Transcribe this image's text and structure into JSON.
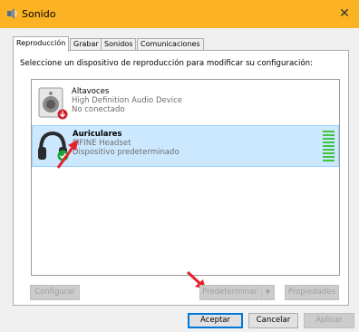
{
  "window": {
    "title": "Sonido",
    "close_glyph": "✕",
    "titlebar_color": "#fcb323"
  },
  "tabs": [
    {
      "label": "Reproducción",
      "active": true
    },
    {
      "label": "Grabar",
      "active": false
    },
    {
      "label": "Sonidos",
      "active": false
    },
    {
      "label": "Comunicaciones",
      "active": false
    }
  ],
  "instruction": "Seleccione un dispositivo de reproducción para modificar su configuración:",
  "devices": [
    {
      "name": "Altavoces",
      "description": "High Definition Audio Device",
      "status": "No conectado",
      "icon": "speaker-icon",
      "badge": "disconnected-arrow-badge",
      "selected": false
    },
    {
      "name": "Auriculares",
      "description": "FIFINE Headset",
      "status": "Dispositivo predeterminado",
      "icon": "headphones-icon",
      "badge": "default-check-badge",
      "selected": true,
      "level": 1.0
    }
  ],
  "buttons": {
    "configure": "Configurar",
    "set_default": "Predeterminar",
    "properties": "Propiedades",
    "accept": "Aceptar",
    "cancel": "Cancelar",
    "apply": "Aplicar"
  },
  "colors": {
    "selection_bg": "#cce8ff",
    "level_meter": "#3fc53f",
    "annotation_arrow": "#e8202a"
  }
}
